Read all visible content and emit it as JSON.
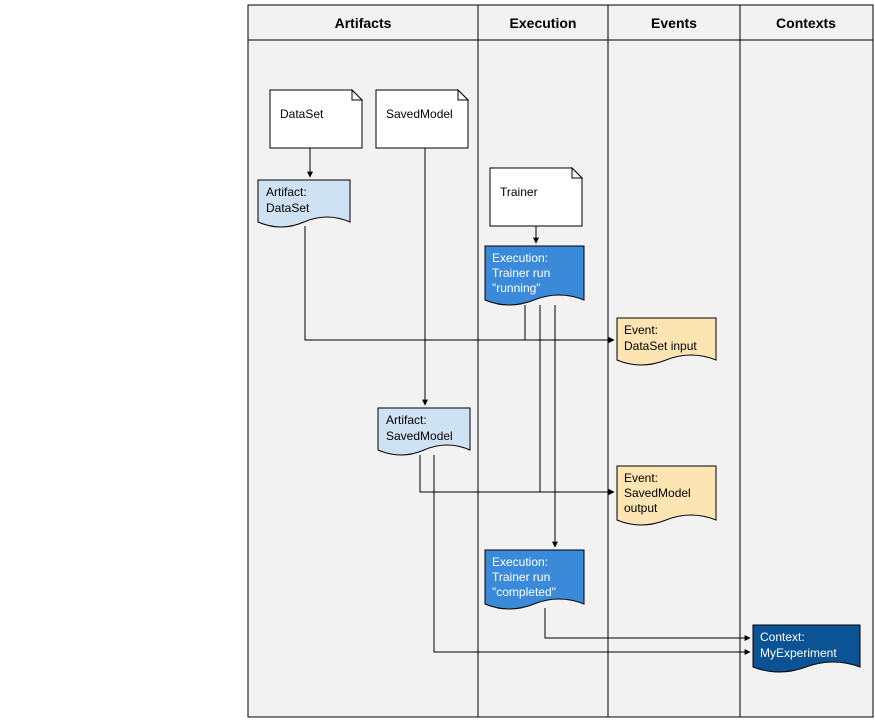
{
  "columns": {
    "artifacts": "Artifacts",
    "execution": "Execution",
    "events": "Events",
    "contexts": "Contexts"
  },
  "docs": {
    "dataset": "DataSet",
    "savedmodel": "SavedModel",
    "trainer": "Trainer"
  },
  "artifacts": {
    "dataset": {
      "line1": "Artifact:",
      "line2": "DataSet"
    },
    "savedmodel": {
      "line1": "Artifact:",
      "line2": "SavedModel"
    }
  },
  "executions": {
    "running": {
      "line1": "Execution:",
      "line2": "Trainer run",
      "line3": "\"running\""
    },
    "completed": {
      "line1": "Execution:",
      "line2": "Trainer run",
      "line3": "\"completed\""
    }
  },
  "events": {
    "dataset_input": {
      "line1": "Event:",
      "line2": "DataSet input"
    },
    "savedmodel_output": {
      "line1": "Event:",
      "line2": "SavedModel",
      "line3": "output"
    }
  },
  "context": {
    "line1": "Context:",
    "line2": "MyExperiment"
  },
  "colors": {
    "grid_bg": "#f2f2f2",
    "border": "#000",
    "artifact_fill": "#cfe2f3",
    "execution_fill": "#3b8ad9",
    "event_fill": "#fce5b2",
    "context_fill": "#0b5394",
    "doc_fill": "#fff"
  }
}
